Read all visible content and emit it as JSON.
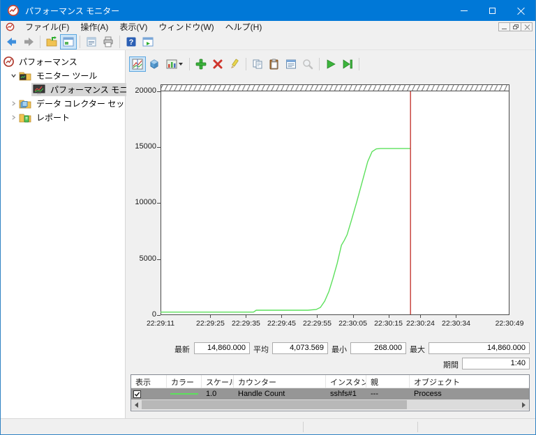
{
  "window": {
    "title": "パフォーマンス モニター"
  },
  "menubar": {
    "items": [
      "ファイル(F)",
      "操作(A)",
      "表示(V)",
      "ウィンドウ(W)",
      "ヘルプ(H)"
    ]
  },
  "toolbar": {
    "icons": [
      "back-icon",
      "forward-icon",
      "show-hide-console-tree-icon",
      "console-window-icon",
      "properties-icon",
      "print-icon",
      "help-icon",
      "new-window-icon"
    ]
  },
  "chart_toolbar": {
    "icons": [
      "view-current-activity-icon",
      "view-log-data-icon",
      "change-graph-type-icon",
      "add-counter-icon",
      "delete-icon",
      "highlight-icon",
      "copy-properties-icon",
      "paste-counter-list-icon",
      "properties-dialog-icon",
      "zoom-icon",
      "freeze-display-icon",
      "update-data-icon"
    ]
  },
  "tree": {
    "root": "パフォーマンス",
    "items": [
      {
        "label": "モニター ツール",
        "expanded": true
      },
      {
        "label": "パフォーマンス モニター",
        "selected": true
      },
      {
        "label": "データ コレクター セット",
        "expanded": false
      },
      {
        "label": "レポート",
        "expanded": false
      }
    ]
  },
  "stats": {
    "latest_label": "最新",
    "latest_value": "14,860.000",
    "average_label": "平均",
    "average_value": "4,073.569",
    "min_label": "最小",
    "min_value": "268.000",
    "max_label": "最大",
    "max_value": "14,860.000",
    "duration_label": "期間",
    "duration_value": "1:40"
  },
  "legend": {
    "columns": [
      "表示",
      "カラー",
      "スケール",
      "カウンター",
      "インスタンス",
      "親",
      "オブジェクト"
    ],
    "rows": [
      {
        "show": true,
        "color": "#5ce05c",
        "scale": "1.0",
        "counter": "Handle Count",
        "instance": "sshfs#1",
        "parent": "---",
        "object": "Process"
      }
    ]
  },
  "chart_data": {
    "type": "line",
    "title": "",
    "xlabel": "",
    "ylabel": "",
    "ylim": [
      0,
      20000
    ],
    "y_ticks": [
      0,
      5000,
      10000,
      15000,
      20000
    ],
    "x_total_sec": 98,
    "x_ticks": [
      {
        "label": "22:29:11",
        "sec": 0
      },
      {
        "label": "22:29:25",
        "sec": 14
      },
      {
        "label": "22:29:35",
        "sec": 24
      },
      {
        "label": "22:29:45",
        "sec": 34
      },
      {
        "label": "22:29:55",
        "sec": 44
      },
      {
        "label": "22:30:05",
        "sec": 54
      },
      {
        "label": "22:30:15",
        "sec": 64
      },
      {
        "label": "22:30:24",
        "sec": 73
      },
      {
        "label": "22:30:34",
        "sec": 83
      },
      {
        "label": "22:30:49",
        "sec": 98
      }
    ],
    "grid": false,
    "legend_position": "bottom-table",
    "series": [
      {
        "name": "Handle Count",
        "color": "#5ce05c",
        "points": [
          [
            0,
            268
          ],
          [
            26.1,
            268
          ],
          [
            26.9,
            436
          ],
          [
            41.4,
            436
          ],
          [
            43.7,
            498
          ],
          [
            44.9,
            685
          ],
          [
            46.1,
            1246
          ],
          [
            47.3,
            2118
          ],
          [
            48.4,
            3240
          ],
          [
            49.6,
            4611
          ],
          [
            50.8,
            6231
          ],
          [
            51.6,
            6667
          ],
          [
            52.4,
            7165
          ],
          [
            53.5,
            8349
          ],
          [
            55.1,
            10093
          ],
          [
            56.7,
            11963
          ],
          [
            58.2,
            13707
          ],
          [
            59.4,
            14579
          ],
          [
            60.6,
            14828
          ],
          [
            61.8,
            14860
          ],
          [
            70.2,
            14860
          ]
        ]
      }
    ],
    "timeline_marker": {
      "sec": 70.2,
      "color": "#c43a33"
    }
  },
  "colors": {
    "titlebar": "#0078d7",
    "accent": "#0078d7",
    "line_green": "#5ce05c",
    "marker_red": "#c43a33",
    "selection_gray": "#969696"
  }
}
